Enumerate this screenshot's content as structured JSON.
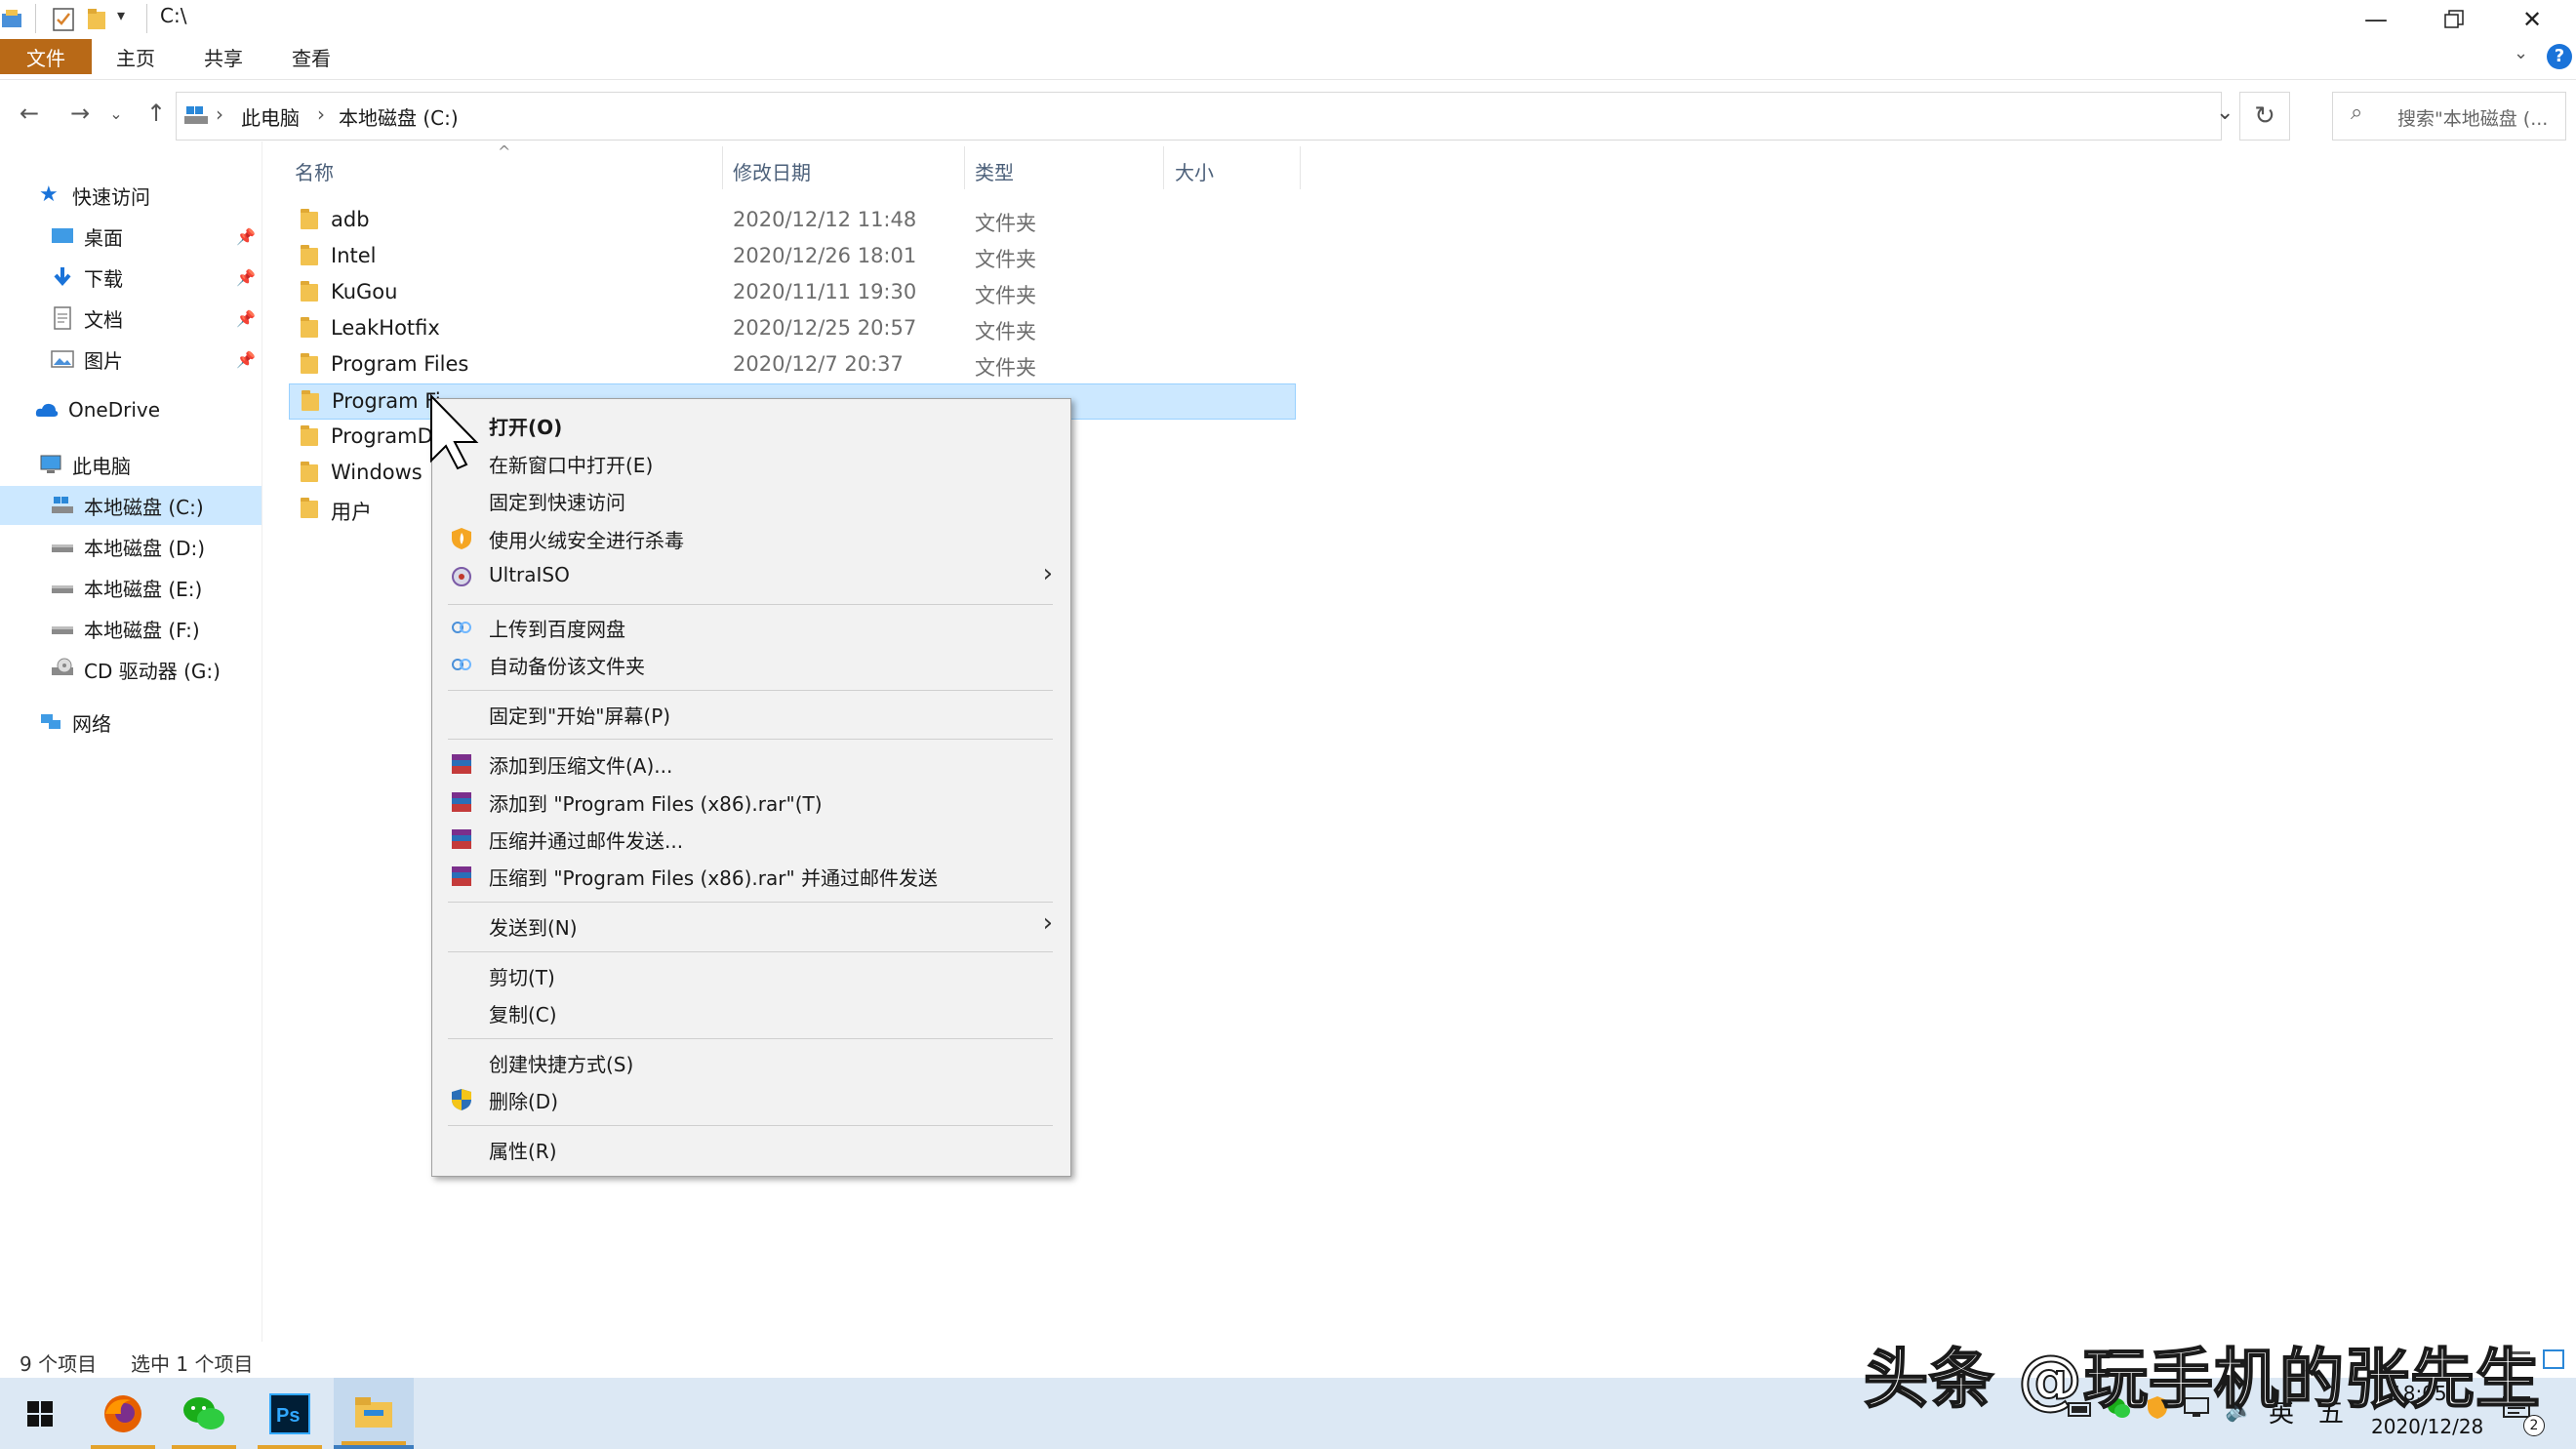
{
  "window": {
    "title": "C:\\"
  },
  "ribbon": {
    "tabs": [
      "文件",
      "主页",
      "共享",
      "查看"
    ]
  },
  "address": {
    "crumbs": [
      "此电脑",
      "本地磁盘 (C:)"
    ],
    "search_placeholder": "搜索\"本地磁盘 (..."
  },
  "nav": {
    "quick_access": "快速访问",
    "items": [
      {
        "label": "桌面",
        "icon": "desktop-icon"
      },
      {
        "label": "下载",
        "icon": "download-icon"
      },
      {
        "label": "文档",
        "icon": "document-icon"
      },
      {
        "label": "图片",
        "icon": "picture-icon"
      }
    ],
    "onedrive": "OneDrive",
    "this_pc": "此电脑",
    "drives": [
      "本地磁盘 (C:)",
      "本地磁盘 (D:)",
      "本地磁盘 (E:)",
      "本地磁盘 (F:)",
      "CD 驱动器 (G:)"
    ],
    "network": "网络"
  },
  "columns": {
    "name": "名称",
    "modified": "修改日期",
    "type": "类型",
    "size": "大小"
  },
  "files": [
    {
      "name": "adb",
      "modified": "2020/12/12 11:48",
      "type": "文件夹"
    },
    {
      "name": "Intel",
      "modified": "2020/12/26 18:01",
      "type": "文件夹"
    },
    {
      "name": "KuGou",
      "modified": "2020/11/11 19:30",
      "type": "文件夹"
    },
    {
      "name": "LeakHotfix",
      "modified": "2020/12/25 20:57",
      "type": "文件夹"
    },
    {
      "name": "Program Files",
      "modified": "2020/12/7 20:37",
      "type": "文件夹"
    },
    {
      "name": "Program Fi",
      "modified": "",
      "type": ""
    },
    {
      "name": "ProgramD",
      "modified": "",
      "type": ""
    },
    {
      "name": "Windows",
      "modified": "",
      "type": ""
    },
    {
      "name": "用户",
      "modified": "",
      "type": ""
    }
  ],
  "context_menu": {
    "open": "打开(O)",
    "open_new_window": "在新窗口中打开(E)",
    "pin_quick_access": "固定到快速访问",
    "huorong_scan": "使用火绒安全进行杀毒",
    "ultraiso": "UltraISO",
    "upload_baidu": "上传到百度网盘",
    "auto_backup": "自动备份该文件夹",
    "pin_start": "固定到\"开始\"屏幕(P)",
    "add_archive": "添加到压缩文件(A)...",
    "add_rar": "添加到 \"Program Files (x86).rar\"(T)",
    "compress_email": "压缩并通过邮件发送...",
    "compress_rar_email": "压缩到 \"Program Files (x86).rar\" 并通过邮件发送",
    "send_to": "发送到(N)",
    "cut": "剪切(T)",
    "copy": "复制(C)",
    "create_shortcut": "创建快捷方式(S)",
    "delete": "删除(D)",
    "properties": "属性(R)"
  },
  "status": {
    "count": "9 个项目",
    "selected": "选中 1 个项目"
  },
  "taskbar": {
    "time": "18:05",
    "date": "2020/12/28",
    "ime_lang": "英",
    "ime_mode": "五",
    "notifications": "2"
  },
  "watermark": "头条 @玩手机的张先生"
}
